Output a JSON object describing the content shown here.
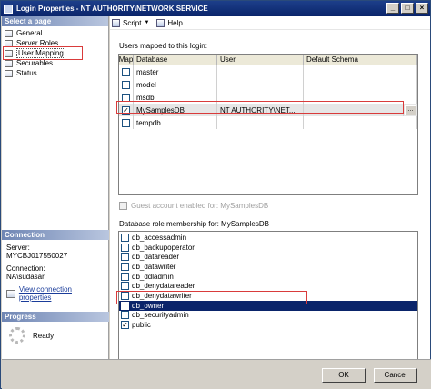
{
  "window": {
    "title": "Login Properties - NT AUTHORITY\\NETWORK SERVICE",
    "controls": [
      "_",
      "□",
      "×"
    ]
  },
  "left": {
    "select_page_header": "Select a page",
    "pages": [
      {
        "label": "General",
        "icon": "page-icon"
      },
      {
        "label": "Server Roles",
        "icon": "page-icon"
      },
      {
        "label": "User Mapping",
        "icon": "page-icon",
        "selected": true
      },
      {
        "label": "Securables",
        "icon": "page-icon"
      },
      {
        "label": "Status",
        "icon": "page-icon"
      }
    ],
    "connection_header": "Connection",
    "server_label": "Server:",
    "server_value": "MYCBJ017550027",
    "connection_label": "Connection:",
    "connection_value": "NA\\sudasari",
    "view_link": "View connection properties",
    "progress_header": "Progress",
    "progress_status": "Ready"
  },
  "toolbar": {
    "script_label": "Script",
    "help_label": "Help"
  },
  "mapping": {
    "label": "Users mapped to this login:",
    "columns": [
      "Map",
      "Database",
      "User",
      "Default Schema"
    ],
    "rows": [
      {
        "checked": false,
        "database": "master",
        "user": "",
        "schema": ""
      },
      {
        "checked": false,
        "database": "model",
        "user": "",
        "schema": ""
      },
      {
        "checked": false,
        "database": "msdb",
        "user": "",
        "schema": ""
      },
      {
        "checked": true,
        "database": "MySamplesDB",
        "user": "NT AUTHORITY\\NET...",
        "schema": "",
        "selected": true,
        "ellipsis": "..."
      },
      {
        "checked": false,
        "database": "tempdb",
        "user": "",
        "schema": ""
      }
    ]
  },
  "guest": {
    "label": "Guest account enabled for: MySamplesDB",
    "checked": false,
    "disabled": true
  },
  "roles": {
    "label": "Database role membership for: MySamplesDB",
    "items": [
      {
        "name": "db_accessadmin",
        "checked": false
      },
      {
        "name": "db_backupoperator",
        "checked": false
      },
      {
        "name": "db_datareader",
        "checked": false
      },
      {
        "name": "db_datawriter",
        "checked": false
      },
      {
        "name": "db_ddladmin",
        "checked": false
      },
      {
        "name": "db_denydatareader",
        "checked": false
      },
      {
        "name": "db_denydatawriter",
        "checked": false
      },
      {
        "name": "db_owner",
        "checked": true,
        "selected": true
      },
      {
        "name": "db_securityadmin",
        "checked": false
      },
      {
        "name": "public",
        "checked": true
      }
    ]
  },
  "buttons": {
    "ok": "OK",
    "cancel": "Cancel"
  },
  "colors": {
    "title_bar": "#0a246a",
    "selection": "#0a246a",
    "highlight_box": "#d93b3b"
  }
}
